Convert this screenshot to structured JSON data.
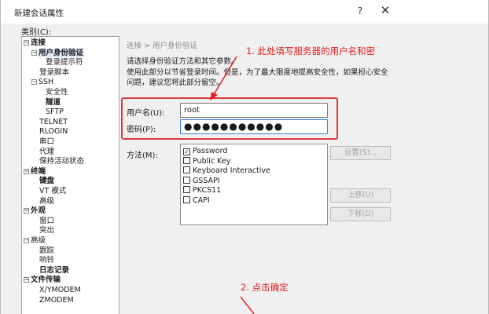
{
  "window": {
    "title": "新建会话属性",
    "help_glyph": "?",
    "close_glyph": "✕"
  },
  "category_label": "类别(C):",
  "tree": [
    {
      "label": "连接",
      "level": 0,
      "bold": true,
      "expander": "−"
    },
    {
      "label": "用户身份验证",
      "level": 1,
      "bold": true,
      "expander": "−",
      "selected": true
    },
    {
      "label": "登录提示符",
      "level": 2,
      "bold": false
    },
    {
      "label": "登录脚本",
      "level": 1,
      "bold": false
    },
    {
      "label": "SSH",
      "level": 1,
      "bold": false,
      "expander": "−"
    },
    {
      "label": "安全性",
      "level": 2,
      "bold": false
    },
    {
      "label": "隧道",
      "level": 2,
      "bold": true
    },
    {
      "label": "SFTP",
      "level": 2,
      "bold": false
    },
    {
      "label": "TELNET",
      "level": 1,
      "bold": false
    },
    {
      "label": "RLOGIN",
      "level": 1,
      "bold": false
    },
    {
      "label": "串口",
      "level": 1,
      "bold": false
    },
    {
      "label": "代理",
      "level": 1,
      "bold": false
    },
    {
      "label": "保持活动状态",
      "level": 1,
      "bold": false
    },
    {
      "label": "终端",
      "level": 0,
      "bold": true,
      "expander": "−"
    },
    {
      "label": "键盘",
      "level": 1,
      "bold": true
    },
    {
      "label": "VT 模式",
      "level": 1,
      "bold": false
    },
    {
      "label": "高级",
      "level": 1,
      "bold": false
    },
    {
      "label": "外观",
      "level": 0,
      "bold": true,
      "expander": "−"
    },
    {
      "label": "窗口",
      "level": 1,
      "bold": false
    },
    {
      "label": "突出",
      "level": 1,
      "bold": false
    },
    {
      "label": "高级",
      "level": 0,
      "bold": false,
      "expander": "−"
    },
    {
      "label": "跟踪",
      "level": 1,
      "bold": false
    },
    {
      "label": "响铃",
      "level": 1,
      "bold": false
    },
    {
      "label": "日志记录",
      "level": 1,
      "bold": true
    },
    {
      "label": "文件传输",
      "level": 0,
      "bold": true,
      "expander": "−"
    },
    {
      "label": "X/YMODEM",
      "level": 1,
      "bold": false
    },
    {
      "label": "ZMODEM",
      "level": 1,
      "bold": false
    }
  ],
  "main": {
    "breadcrumb": "连接 > 用户身份验证",
    "desc1": "请选择身份验证方法和其它参数。",
    "desc2": "使用此部分以节省登录时间。但是，为了最大限度地提高安全性，如果担心安全问题，建议您将此部分留空。",
    "username_label": "用户名(U):",
    "username_value": "root",
    "password_label": "密码(P):",
    "password_value": "●●●●●●●●●●●",
    "method_label": "方法(M):",
    "methods": [
      {
        "label": "Password",
        "checked": true
      },
      {
        "label": "Public Key",
        "checked": false
      },
      {
        "label": "Keyboard Interactive",
        "checked": false
      },
      {
        "label": "GSSAPI",
        "checked": false
      },
      {
        "label": "PKCS11",
        "checked": false
      },
      {
        "label": "CAPI",
        "checked": false
      }
    ],
    "buttons": {
      "settings": "设置(S)...",
      "move_up": "上移(U)",
      "move_down": "下移(D)"
    }
  },
  "annotations": {
    "step1": "1. 此处填写服务器的用户名和密",
    "step2": "2. 点击确定",
    "color": "#e02020"
  }
}
